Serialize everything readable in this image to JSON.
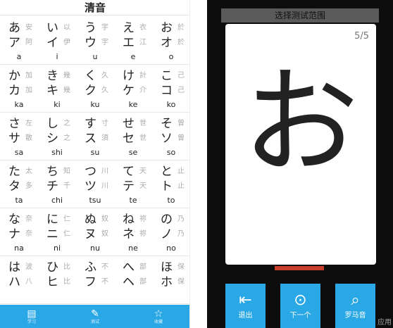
{
  "left": {
    "title": "清音",
    "rows": [
      [
        {
          "hira": "あ",
          "kata": "ア",
          "kanji_h": "安",
          "kanji_k": "阿",
          "roma": "a"
        },
        {
          "hira": "い",
          "kata": "イ",
          "kanji_h": "以",
          "kanji_k": "伊",
          "roma": "i"
        },
        {
          "hira": "う",
          "kata": "ウ",
          "kanji_h": "宇",
          "kanji_k": "宇",
          "roma": "u"
        },
        {
          "hira": "え",
          "kata": "エ",
          "kanji_h": "衣",
          "kanji_k": "江",
          "roma": "e"
        },
        {
          "hira": "お",
          "kata": "オ",
          "kanji_h": "於",
          "kanji_k": "於",
          "roma": "o"
        }
      ],
      [
        {
          "hira": "か",
          "kata": "カ",
          "kanji_h": "加",
          "kanji_k": "加",
          "roma": "ka"
        },
        {
          "hira": "き",
          "kata": "キ",
          "kanji_h": "幾",
          "kanji_k": "幾",
          "roma": "ki"
        },
        {
          "hira": "く",
          "kata": "ク",
          "kanji_h": "久",
          "kanji_k": "久",
          "roma": "ku"
        },
        {
          "hira": "け",
          "kata": "ケ",
          "kanji_h": "計",
          "kanji_k": "介",
          "roma": "ke"
        },
        {
          "hira": "こ",
          "kata": "コ",
          "kanji_h": "己",
          "kanji_k": "己",
          "roma": "ko"
        }
      ],
      [
        {
          "hira": "さ",
          "kata": "サ",
          "kanji_h": "左",
          "kanji_k": "散",
          "roma": "sa"
        },
        {
          "hira": "し",
          "kata": "シ",
          "kanji_h": "之",
          "kanji_k": "之",
          "roma": "shi"
        },
        {
          "hira": "す",
          "kata": "ス",
          "kanji_h": "寸",
          "kanji_k": "須",
          "roma": "su"
        },
        {
          "hira": "せ",
          "kata": "セ",
          "kanji_h": "世",
          "kanji_k": "世",
          "roma": "se"
        },
        {
          "hira": "そ",
          "kata": "ソ",
          "kanji_h": "曾",
          "kanji_k": "曾",
          "roma": "so"
        }
      ],
      [
        {
          "hira": "た",
          "kata": "タ",
          "kanji_h": "太",
          "kanji_k": "多",
          "roma": "ta"
        },
        {
          "hira": "ち",
          "kata": "チ",
          "kanji_h": "知",
          "kanji_k": "千",
          "roma": "chi"
        },
        {
          "hira": "つ",
          "kata": "ツ",
          "kanji_h": "川",
          "kanji_k": "川",
          "roma": "tsu"
        },
        {
          "hira": "て",
          "kata": "テ",
          "kanji_h": "天",
          "kanji_k": "天",
          "roma": "te"
        },
        {
          "hira": "と",
          "kata": "ト",
          "kanji_h": "止",
          "kanji_k": "止",
          "roma": "to"
        }
      ],
      [
        {
          "hira": "な",
          "kata": "ナ",
          "kanji_h": "奈",
          "kanji_k": "奈",
          "roma": "na"
        },
        {
          "hira": "に",
          "kata": "ニ",
          "kanji_h": "仁",
          "kanji_k": "仁",
          "roma": "ni"
        },
        {
          "hira": "ぬ",
          "kata": "ヌ",
          "kanji_h": "奴",
          "kanji_k": "奴",
          "roma": "nu"
        },
        {
          "hira": "ね",
          "kata": "ネ",
          "kanji_h": "祢",
          "kanji_k": "祢",
          "roma": "ne"
        },
        {
          "hira": "の",
          "kata": "ノ",
          "kanji_h": "乃",
          "kanji_k": "乃",
          "roma": "no"
        }
      ],
      [
        {
          "hira": "は",
          "kata": "ハ",
          "kanji_h": "波",
          "kanji_k": "八",
          "roma": ""
        },
        {
          "hira": "ひ",
          "kata": "ヒ",
          "kanji_h": "比",
          "kanji_k": "比",
          "roma": ""
        },
        {
          "hira": "ふ",
          "kata": "フ",
          "kanji_h": "不",
          "kanji_k": "不",
          "roma": ""
        },
        {
          "hira": "へ",
          "kata": "ヘ",
          "kanji_h": "部",
          "kanji_k": "部",
          "roma": ""
        },
        {
          "hira": "ほ",
          "kata": "ホ",
          "kanji_h": "保",
          "kanji_k": "保",
          "roma": ""
        }
      ]
    ],
    "tabs": [
      {
        "icon": "book-icon",
        "glyph": "▤",
        "label": "学习"
      },
      {
        "icon": "edit-icon",
        "glyph": "✎",
        "label": "测试"
      },
      {
        "icon": "star-icon",
        "glyph": "☆",
        "label": "收藏"
      }
    ]
  },
  "right": {
    "header": "选择测试范围",
    "progress": "5/5",
    "character": "お",
    "buttons": [
      {
        "icon": "exit-icon",
        "glyph": "⇤",
        "label": "退出"
      },
      {
        "icon": "next-icon",
        "glyph": "⊙",
        "label": "下一个"
      },
      {
        "icon": "search-icon",
        "glyph": "⌕",
        "label": "罗马音"
      }
    ],
    "watermark": "应用"
  },
  "colors": {
    "accent": "#2aa8e6",
    "card_bg": "#ffffff",
    "screen_bg": "#0c0c0c",
    "strip": "#c8402c"
  }
}
